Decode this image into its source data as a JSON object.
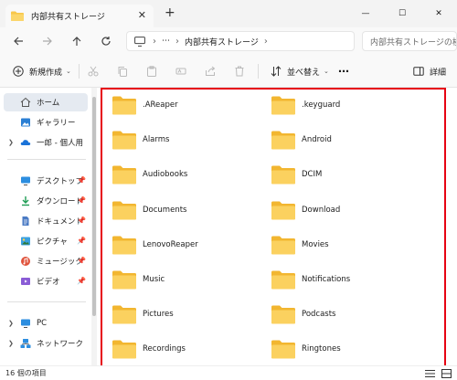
{
  "window": {
    "tab_title": "内部共有ストレージ",
    "tab_close": "✕",
    "new_tab": "+",
    "minimize": "—",
    "maximize": "☐",
    "close": "✕"
  },
  "addressbar": {
    "more": "⋯",
    "breadcrumb": "内部共有ストレージ",
    "search_placeholder": "内部共有ストレージの検索"
  },
  "commandbar": {
    "new_label": "新規作成",
    "sort_label": "並べ替え",
    "more": "⋯",
    "details_label": "詳細"
  },
  "sidebar": {
    "items": [
      {
        "label": "ホーム",
        "icon": "home-icon",
        "selected": true
      },
      {
        "label": "ギャラリー",
        "icon": "gallery-icon"
      },
      {
        "label": "一郎 - 個人用",
        "icon": "cloud-icon",
        "expandable": true
      },
      {
        "label": "デスクトップ",
        "icon": "desktop-icon",
        "pinned": true
      },
      {
        "label": "ダウンロード",
        "icon": "download-icon",
        "pinned": true
      },
      {
        "label": "ドキュメント",
        "icon": "documents-icon",
        "pinned": true
      },
      {
        "label": "ピクチャ",
        "icon": "pictures-icon",
        "pinned": true
      },
      {
        "label": "ミュージック",
        "icon": "music-icon",
        "pinned": true
      },
      {
        "label": "ビデオ",
        "icon": "video-icon",
        "pinned": true
      },
      {
        "label": "PC",
        "icon": "pc-icon",
        "expandable": true
      },
      {
        "label": "ネットワーク",
        "icon": "network-icon",
        "expandable": true
      }
    ]
  },
  "folders": [
    ".AReaper",
    ".keyguard",
    "Alarms",
    "Android",
    "Audiobooks",
    "DCIM",
    "Documents",
    "Download",
    "LenovoReaper",
    "Movies",
    "Music",
    "Notifications",
    "Pictures",
    "Podcasts",
    "Recordings",
    "Ringtones"
  ],
  "status": {
    "item_count": "16 個の項目"
  },
  "colors": {
    "highlight_border": "#e60012",
    "folder_yellow": "#f8c74a",
    "selected_nav": "#e5eaf1"
  }
}
